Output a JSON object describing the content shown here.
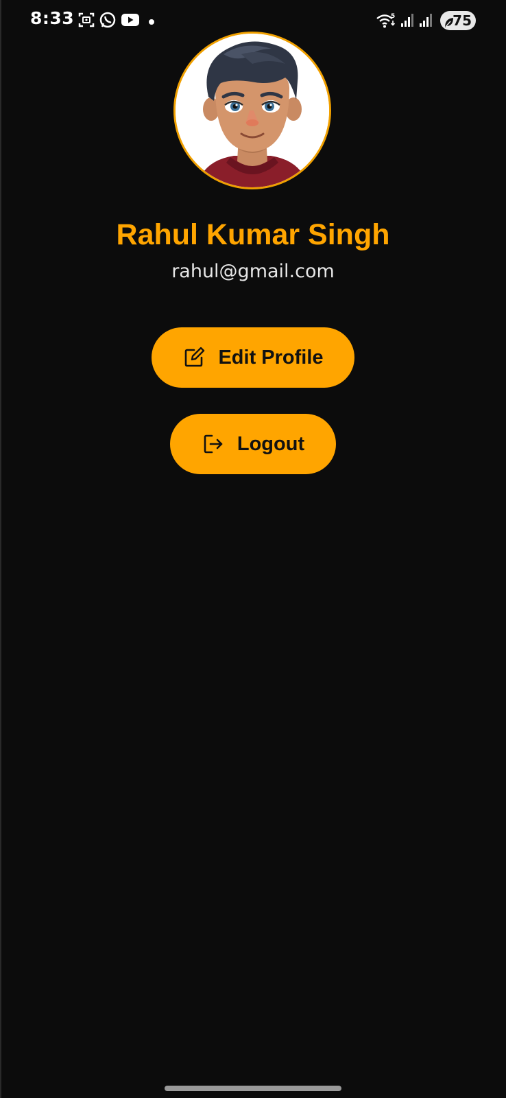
{
  "status_bar": {
    "time": "8:33",
    "battery": "75",
    "icons": [
      "screenshot-icon",
      "whatsapp-icon",
      "youtube-icon",
      "notification-dot-icon",
      "wifi-icon",
      "signal-icon",
      "signal-icon",
      "battery-icon"
    ]
  },
  "profile": {
    "name": "Rahul Kumar Singh",
    "email": "rahul@gmail.com",
    "avatar_icon": "avatar-illustration"
  },
  "actions": {
    "edit_label": "Edit Profile",
    "edit_icon": "edit-icon",
    "logout_label": "Logout",
    "logout_icon": "logout-icon"
  },
  "colors": {
    "background": "#0c0c0c",
    "accent": "#ffa500",
    "text_primary": "#ffffff",
    "text_secondary": "#e6e6e6"
  }
}
